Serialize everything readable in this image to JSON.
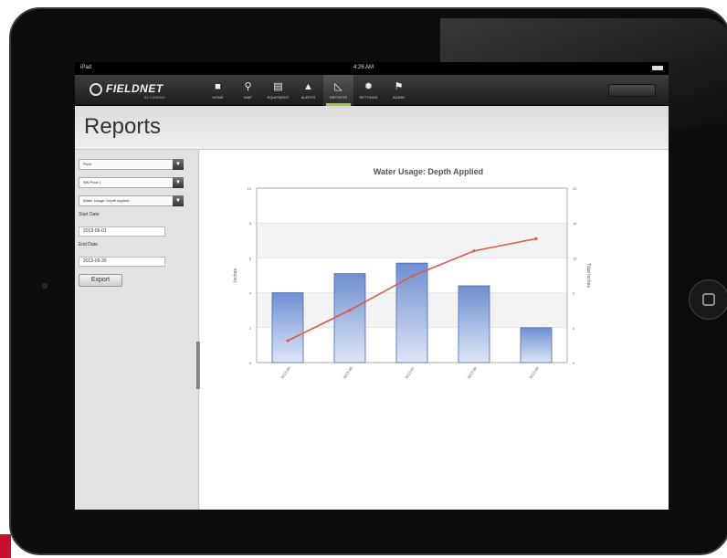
{
  "status_bar": {
    "carrier": "iPad",
    "time": "4:26 AM"
  },
  "app": {
    "logo": "FIELDNET",
    "logo_sub": "BY LINDSAY"
  },
  "nav": {
    "items": [
      {
        "label": "HOME",
        "icon": "home-icon",
        "glyph": "■"
      },
      {
        "label": "MAP",
        "icon": "map-pin-icon",
        "glyph": "⚲"
      },
      {
        "label": "EQUIPMENT",
        "icon": "equipment-icon",
        "glyph": "▤"
      },
      {
        "label": "ALERTS",
        "icon": "alert-icon",
        "glyph": "▲"
      },
      {
        "label": "REPORTS",
        "icon": "reports-icon",
        "glyph": "◺"
      },
      {
        "label": "SETTINGS",
        "icon": "gear-icon",
        "glyph": "✹"
      },
      {
        "label": "ADMIN",
        "icon": "admin-icon",
        "glyph": "⚑"
      }
    ],
    "active": "REPORTS",
    "active_color": "#9acd32"
  },
  "page": {
    "title": "Reports"
  },
  "sidebar": {
    "select_1": "Pivot",
    "select_2": "SW Pivot 1",
    "select_3": "Water Usage: Depth Applied",
    "start_label": "Start Date",
    "start_value": "2013-06-01",
    "end_label": "End Date",
    "end_value": "2013-09-30",
    "export_label": "Export"
  },
  "chart_data": {
    "type": "bar",
    "title": "Water Usage: Depth Applied",
    "ylabel": "Inches",
    "y2label": "Total Inches",
    "ylim": [
      0,
      10
    ],
    "y2lim": [
      0,
      20
    ],
    "categories": [
      "2013-05",
      "2013-06",
      "2013-07",
      "2013-08",
      "2013-09"
    ],
    "series": [
      {
        "type": "bar",
        "values": [
          4.0,
          5.1,
          5.7,
          4.4,
          2.0
        ],
        "color": "#6f8fd0"
      },
      {
        "type": "line",
        "values": [
          2.5,
          6.0,
          9.9,
          12.8,
          14.2
        ],
        "color": "#e05a4a"
      }
    ],
    "grid": true
  }
}
